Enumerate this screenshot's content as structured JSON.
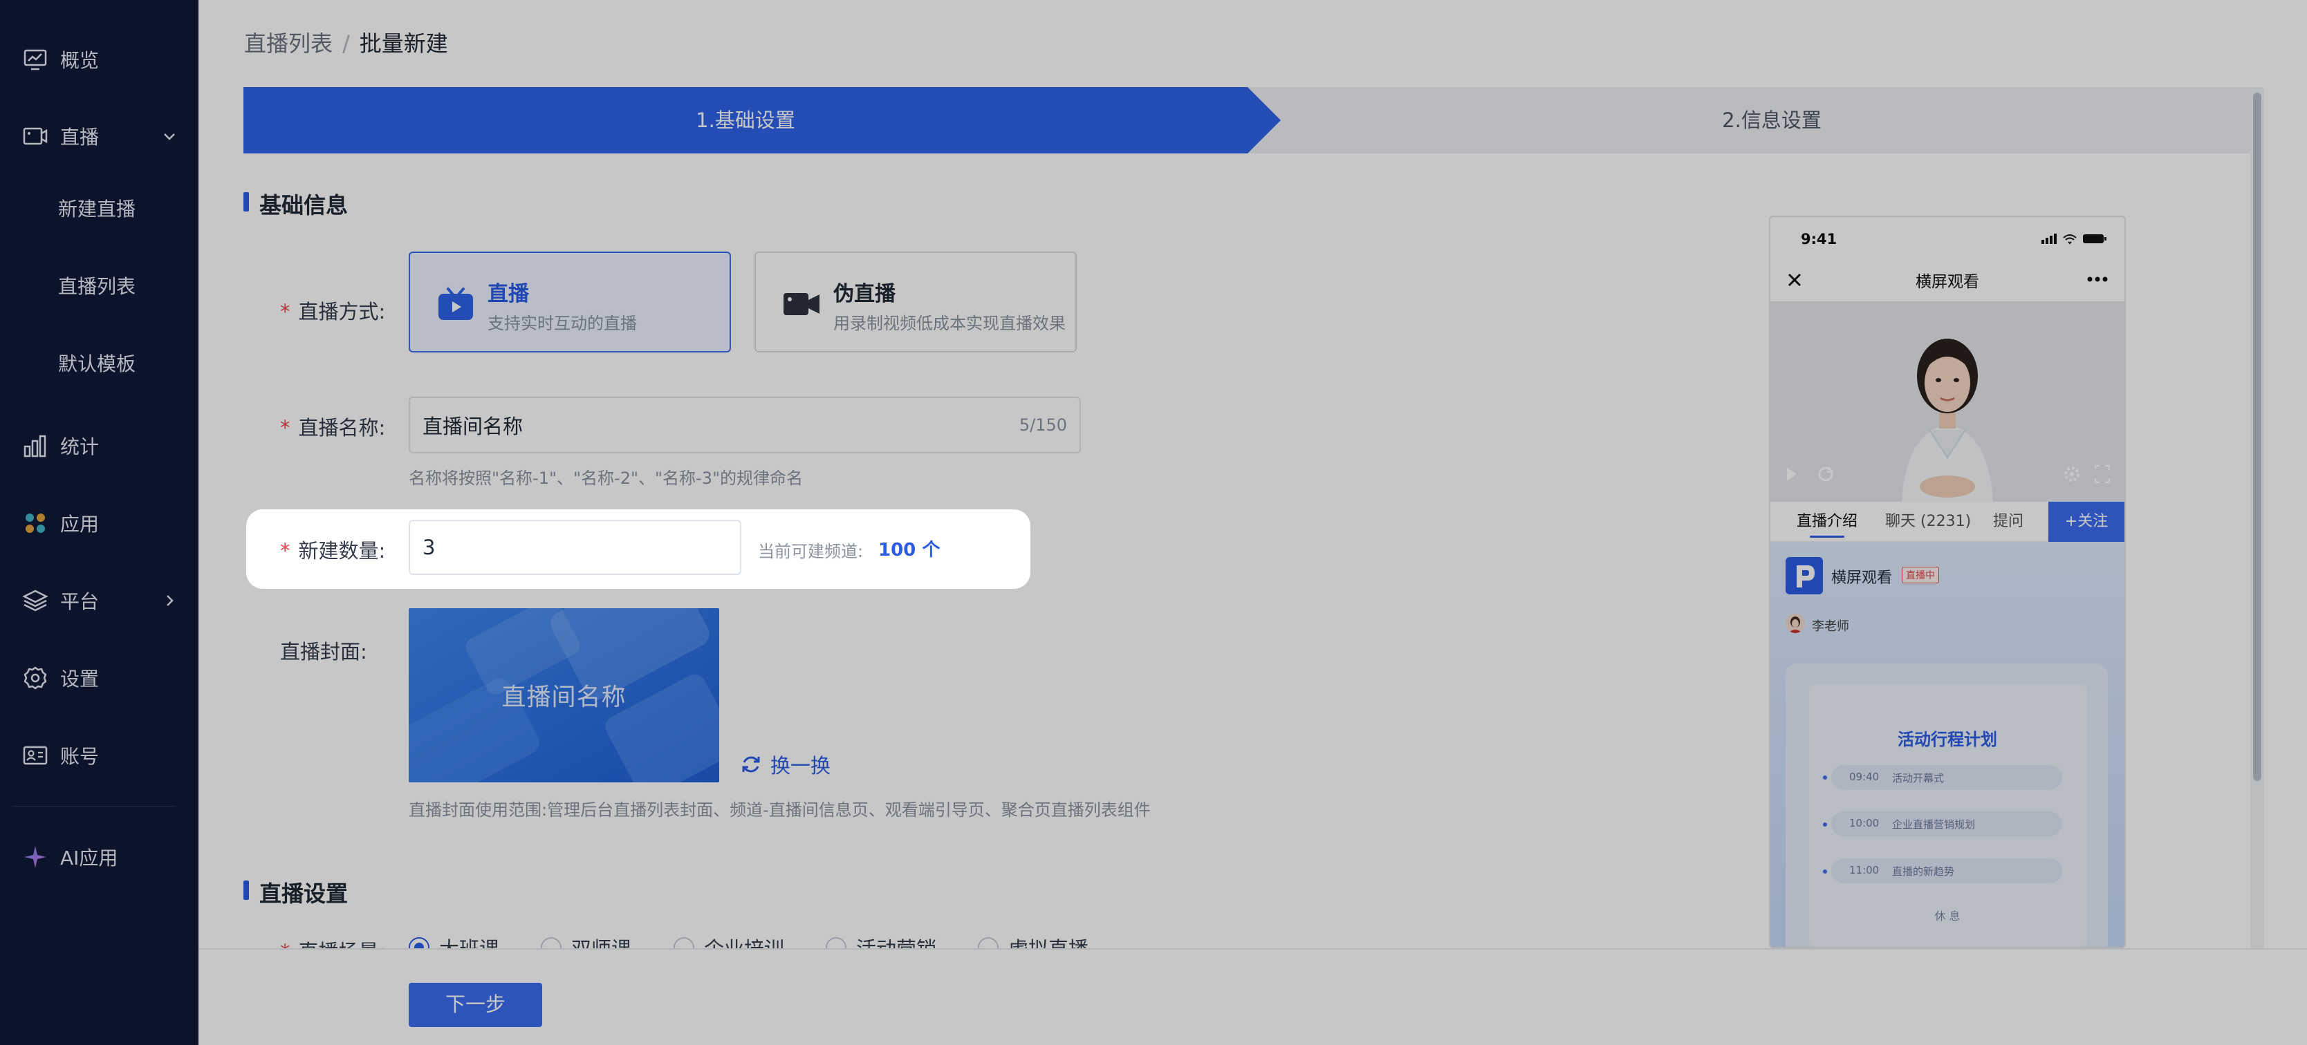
{
  "sidebar": {
    "items": [
      {
        "label": "概览",
        "icon": "monitor-icon"
      },
      {
        "label": "直播",
        "icon": "live-camera-icon"
      },
      {
        "label": "新建直播"
      },
      {
        "label": "直播列表"
      },
      {
        "label": "默认模板"
      },
      {
        "label": "统计",
        "icon": "bar-chart-icon"
      },
      {
        "label": "应用",
        "icon": "apps-icon"
      },
      {
        "label": "平台",
        "icon": "layers-icon"
      },
      {
        "label": "设置",
        "icon": "gear-icon"
      },
      {
        "label": "账号",
        "icon": "id-card-icon"
      },
      {
        "label": "AI应用",
        "icon": "sparkle-icon"
      }
    ]
  },
  "breadcrumb": {
    "parent": "直播列表",
    "separator": "/",
    "current": "批量新建"
  },
  "steps": [
    {
      "label": "1.基础设置",
      "active": true
    },
    {
      "label": "2.信息设置",
      "active": false
    }
  ],
  "sections": {
    "basic": "基础信息",
    "live_settings": "直播设置"
  },
  "form": {
    "mode_label": "直播方式:",
    "modes": [
      {
        "title": "直播",
        "desc": "支持实时互动的直播",
        "selected": true
      },
      {
        "title": "伪直播",
        "desc": "用录制视频低成本实现直播效果",
        "selected": false
      }
    ],
    "name_label": "直播名称:",
    "name_value": "直播间名称",
    "name_count": "5/150",
    "name_hint": "名称将按照\"名称-1\"、\"名称-2\"、\"名称-3\"的规律命名",
    "qty_label": "新建数量:",
    "qty_value": "3",
    "channel_label": "当前可建频道:",
    "channel_value": "100 个",
    "cover_label": "直播封面:",
    "cover_text": "直播间名称",
    "swap_label": "换一换",
    "cover_hint": "直播封面使用范围:管理后台直播列表封面、频道-直播间信息页、观看端引导页、聚合页直播列表组件",
    "scene_label": "直播场景:",
    "scenes": [
      {
        "label": "大班课",
        "selected": true
      },
      {
        "label": "双师课",
        "selected": false
      },
      {
        "label": "企业培训",
        "selected": false
      },
      {
        "label": "活动营销",
        "selected": false
      },
      {
        "label": "虚拟直播",
        "selected": false
      }
    ]
  },
  "footer": {
    "next_label": "下一步"
  },
  "preview": {
    "time": "9:41",
    "title": "横屏观看",
    "tabs": [
      "直播介绍",
      "聊天 (2231)",
      "提问"
    ],
    "follow": "+关注",
    "channel_name": "横屏观看",
    "live_badge": "直播中",
    "teacher": "李老师",
    "plan_title": "活动行程计划",
    "schedule": [
      {
        "time": "09:40",
        "event": "活动开幕式"
      },
      {
        "time": "10:00",
        "event": "企业直播营销规划"
      },
      {
        "time": "11:00",
        "event": "直播的新趋势"
      }
    ],
    "rest": "休 息"
  },
  "colors": {
    "sidebar_bg": "#0f1a38",
    "accent": "#3b6cf0",
    "overlay": "rgba(0,0,0,0.22)",
    "required": "#e5484d"
  }
}
